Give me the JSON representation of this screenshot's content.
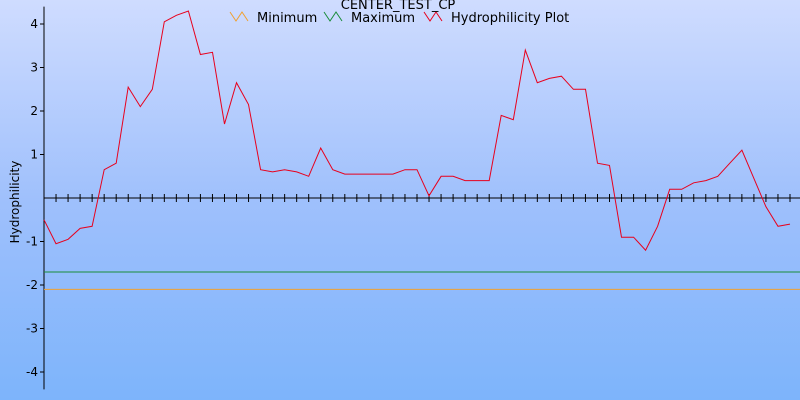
{
  "chart_data": {
    "type": "line",
    "title": "CENTER_TEST_CP",
    "ylabel": "Hydrophilicity",
    "xlabel": "",
    "ylim": [
      -4.4,
      4.4
    ],
    "yticks": [
      -4,
      -3,
      -2,
      -1,
      1,
      2,
      3,
      4
    ],
    "grid": false,
    "legend_position": "top",
    "colors": {
      "minimum": "#f0a030",
      "maximum": "#1a8c3a",
      "hydrophilicity": "#e8001c"
    },
    "series": [
      {
        "name": "Minimum",
        "values": [
          -2.1,
          -2.1
        ]
      },
      {
        "name": "Maximum",
        "values": [
          -1.7,
          -1.7
        ]
      },
      {
        "name": "Hydrophilicity Plot",
        "values": [
          -0.5,
          -1.05,
          -0.95,
          -0.7,
          -0.65,
          0.65,
          0.8,
          2.55,
          2.1,
          2.5,
          4.05,
          4.2,
          4.3,
          3.3,
          3.35,
          1.7,
          2.65,
          2.15,
          0.65,
          0.6,
          0.65,
          0.6,
          0.5,
          1.15,
          0.65,
          0.55,
          0.55,
          0.55,
          0.55,
          0.55,
          0.65,
          0.65,
          0.05,
          0.5,
          0.5,
          0.4,
          0.4,
          0.4,
          1.9,
          1.8,
          3.4,
          2.65,
          2.75,
          2.8,
          2.5,
          2.5,
          0.8,
          0.75,
          -0.9,
          -0.9,
          -1.2,
          -0.65,
          0.2,
          0.2,
          0.35,
          0.4,
          0.5,
          0.8,
          1.1,
          0.45,
          -0.2,
          -0.65,
          -0.6
        ]
      }
    ]
  }
}
